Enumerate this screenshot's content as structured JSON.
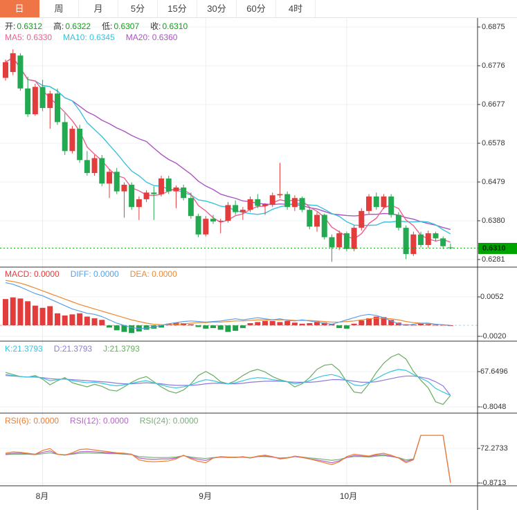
{
  "colors": {
    "accent_tab": "#ef7446",
    "up": "#e23c3c",
    "down": "#23a94f",
    "ohlc_value_green": "#0da314",
    "ma5": "#ee5f8e",
    "ma10": "#36c2dc",
    "ma20": "#ab53c3",
    "macd_bar_pos": "#e23c3c",
    "macd_bar_neg": "#1fa04a",
    "diff": "#58a0e8",
    "dea": "#f0882e",
    "k": "#38c4de",
    "d": "#8f7ad8",
    "j": "#68ac60",
    "rsi6": "#ef7c2e",
    "rsi12": "#b564c9",
    "rsi24": "#78ae78",
    "price_line": "#00a400",
    "grid": "#edf2f6",
    "grid_vertical": "#e7eef4",
    "axis_line": "#333333",
    "separator": "#333333",
    "text": "#333333"
  },
  "tabs": [
    {
      "label": "日",
      "active": true
    },
    {
      "label": "周",
      "active": false
    },
    {
      "label": "月",
      "active": false
    },
    {
      "label": "5分",
      "active": false
    },
    {
      "label": "15分",
      "active": false
    },
    {
      "label": "30分",
      "active": false
    },
    {
      "label": "60分",
      "active": false
    },
    {
      "label": "4时",
      "active": false
    }
  ],
  "main_chart": {
    "legend_ohlc": [
      {
        "label": "开:",
        "value": "0.6312"
      },
      {
        "label": "高:",
        "value": "0.6322"
      },
      {
        "label": "低:",
        "value": "0.6307"
      },
      {
        "label": "收:",
        "value": "0.6310"
      }
    ],
    "legend_ma": [
      {
        "text": "MA5: 0.6330",
        "color_key": "ma5"
      },
      {
        "text": "MA10: 0.6345",
        "color_key": "ma10"
      },
      {
        "text": "MA20: 0.6360",
        "color_key": "ma20"
      }
    ]
  },
  "y_axis": {
    "labels": [
      {
        "text": "0.6875",
        "value": 0.6875
      },
      {
        "text": "0.6776",
        "value": 0.6776
      },
      {
        "text": "0.6677",
        "value": 0.6677
      },
      {
        "text": "0.6578",
        "value": 0.6578
      },
      {
        "text": "0.6479",
        "value": 0.6479
      },
      {
        "text": "0.6380",
        "value": 0.638
      },
      {
        "text": "0.6281",
        "value": 0.6281
      }
    ],
    "current_price": {
      "text": "0.6310",
      "value": 0.631
    }
  },
  "x_axis": {
    "labels": [
      {
        "text": "8月",
        "candle_index": 5
      },
      {
        "text": "9月",
        "candle_index": 27
      },
      {
        "text": "10月",
        "candle_index": 46
      }
    ]
  },
  "panels": {
    "macd": {
      "legend": [
        {
          "text": "MACD: 0.0000",
          "color_key": "macd_bar_pos"
        },
        {
          "text": "DIFF: 0.0000",
          "color_key": "diff"
        },
        {
          "text": "DEA: 0.0000",
          "color_key": "dea"
        }
      ],
      "axis_labels": [
        {
          "text": "0.0052",
          "value": 0.0052
        },
        {
          "text": "-0.0020",
          "value": -0.002
        }
      ]
    },
    "kdj": {
      "legend": [
        {
          "text": "K:21.3793",
          "color_key": "k"
        },
        {
          "text": "D:21.3793",
          "color_key": "d"
        },
        {
          "text": "J:21.3793",
          "color_key": "j"
        }
      ],
      "axis_labels": [
        {
          "text": "67.6496",
          "value": 67.6496
        },
        {
          "text": "-0.8048",
          "value": -0.8048
        }
      ]
    },
    "rsi": {
      "legend": [
        {
          "text": "RSI(6): 0.0000",
          "color_key": "rsi6"
        },
        {
          "text": "RSI(12): 0.0000",
          "color_key": "rsi12"
        },
        {
          "text": "RSI(24): 0.0000",
          "color_key": "rsi24"
        }
      ],
      "axis_labels": [
        {
          "text": "72.2733",
          "value": 72.2733
        },
        {
          "text": "-0.8713",
          "value": -0.8713
        }
      ]
    }
  },
  "chart_data": {
    "type": "candlestick",
    "period": "日",
    "title": "",
    "ylim_main": [
      0.6281,
      0.6875
    ],
    "ylim_macd": [
      -0.002,
      0.0052
    ],
    "ylim_kdj": [
      -0.8048,
      67.6496
    ],
    "ylim_rsi": [
      -0.8713,
      72.2733
    ],
    "ma_periods": [
      5,
      10,
      20
    ],
    "candles": [
      [
        0.6745,
        0.6792,
        0.6738,
        0.6785
      ],
      [
        0.676,
        0.6818,
        0.6752,
        0.6808
      ],
      [
        0.6802,
        0.6808,
        0.6712,
        0.6718
      ],
      [
        0.6718,
        0.6748,
        0.6645,
        0.6652
      ],
      [
        0.6652,
        0.673,
        0.6648,
        0.6722
      ],
      [
        0.6722,
        0.674,
        0.666,
        0.6668
      ],
      [
        0.6668,
        0.6712,
        0.6615,
        0.6705
      ],
      [
        0.6705,
        0.6718,
        0.6625,
        0.6632
      ],
      [
        0.6632,
        0.6655,
        0.6548,
        0.6558
      ],
      [
        0.6558,
        0.6622,
        0.6552,
        0.6615
      ],
      [
        0.6615,
        0.6625,
        0.6528,
        0.6535
      ],
      [
        0.6535,
        0.6558,
        0.6495,
        0.6502
      ],
      [
        0.6502,
        0.6548,
        0.6495,
        0.654
      ],
      [
        0.654,
        0.6548,
        0.6468,
        0.6475
      ],
      [
        0.6475,
        0.6512,
        0.6438,
        0.6505
      ],
      [
        0.6505,
        0.6515,
        0.6448,
        0.6455
      ],
      [
        0.6455,
        0.6478,
        0.6388,
        0.6472
      ],
      [
        0.6472,
        0.6478,
        0.6408,
        0.6415
      ],
      [
        0.6415,
        0.6442,
        0.6382,
        0.6435
      ],
      [
        0.6435,
        0.6458,
        0.6428,
        0.6452
      ],
      [
        0.6452,
        0.6468,
        0.6382,
        0.6448
      ],
      [
        0.6448,
        0.6495,
        0.6442,
        0.6488
      ],
      [
        0.6488,
        0.6495,
        0.6448,
        0.6455
      ],
      [
        0.6455,
        0.647,
        0.6412,
        0.6465
      ],
      [
        0.6465,
        0.6472,
        0.6432,
        0.6438
      ],
      [
        0.6438,
        0.6452,
        0.6385,
        0.6392
      ],
      [
        0.6392,
        0.6398,
        0.6338,
        0.6345
      ],
      [
        0.6345,
        0.6392,
        0.634,
        0.6385
      ],
      [
        0.6385,
        0.6395,
        0.6372,
        0.6378
      ],
      [
        0.6378,
        0.6385,
        0.6348,
        0.638
      ],
      [
        0.638,
        0.6428,
        0.6375,
        0.642
      ],
      [
        0.642,
        0.6432,
        0.6395,
        0.6402
      ],
      [
        0.6402,
        0.6415,
        0.6382,
        0.6408
      ],
      [
        0.6408,
        0.6442,
        0.6402,
        0.6435
      ],
      [
        0.6435,
        0.6448,
        0.6412,
        0.6418
      ],
      [
        0.6418,
        0.6425,
        0.6395,
        0.6422
      ],
      [
        0.6422,
        0.6452,
        0.6415,
        0.6445
      ],
      [
        0.6445,
        0.6528,
        0.6438,
        0.6448
      ],
      [
        0.6448,
        0.6455,
        0.6408,
        0.6415
      ],
      [
        0.6415,
        0.6445,
        0.6405,
        0.6438
      ],
      [
        0.6438,
        0.6442,
        0.6402,
        0.6408
      ],
      [
        0.6408,
        0.6415,
        0.6358,
        0.6365
      ],
      [
        0.6365,
        0.6402,
        0.6352,
        0.6395
      ],
      [
        0.6395,
        0.6398,
        0.6332,
        0.6338
      ],
      [
        0.6338,
        0.6345,
        0.6275,
        0.6312
      ],
      [
        0.6312,
        0.6355,
        0.6305,
        0.6348
      ],
      [
        0.6348,
        0.6352,
        0.6302,
        0.6308
      ],
      [
        0.6308,
        0.6368,
        0.6302,
        0.6362
      ],
      [
        0.6362,
        0.6412,
        0.6355,
        0.6405
      ],
      [
        0.6405,
        0.6448,
        0.6398,
        0.6442
      ],
      [
        0.6442,
        0.6452,
        0.6408,
        0.6415
      ],
      [
        0.6415,
        0.6448,
        0.641,
        0.6442
      ],
      [
        0.6442,
        0.6448,
        0.6388,
        0.6395
      ],
      [
        0.6395,
        0.6402,
        0.6355,
        0.6362
      ],
      [
        0.6362,
        0.6368,
        0.6282,
        0.6295
      ],
      [
        0.6295,
        0.6352,
        0.629,
        0.6345
      ],
      [
        0.6345,
        0.6352,
        0.6312,
        0.6318
      ],
      [
        0.6318,
        0.6355,
        0.631,
        0.6348
      ],
      [
        0.6348,
        0.6352,
        0.6328,
        0.6335
      ],
      [
        0.6335,
        0.634,
        0.6308,
        0.6315
      ],
      [
        0.6312,
        0.6322,
        0.6307,
        0.631
      ]
    ],
    "macd": {
      "hist": [
        0.0048,
        0.0051,
        0.0049,
        0.0044,
        0.0036,
        0.0032,
        0.0035,
        0.0022,
        0.0018,
        0.002,
        0.0022,
        0.0016,
        0.0013,
        0.001,
        -0.0004,
        -0.0009,
        -0.0012,
        -0.0014,
        -0.0011,
        -0.0008,
        -0.0006,
        -0.0004,
        0.0003,
        0.0005,
        0.0004,
        0.0002,
        -0.0003,
        -0.0006,
        -0.0005,
        -0.0008,
        -0.0012,
        -0.001,
        -0.0005,
        0.0004,
        0.0006,
        0.0008,
        0.0008,
        0.0006,
        0.0008,
        0.0005,
        0.0003,
        0.0004,
        0.0007,
        0.0005,
        0.0003,
        -0.0005,
        -0.0006,
        0.0003,
        0.0009,
        0.0013,
        0.0016,
        0.0015,
        0.001,
        0.0005,
        0.0002,
        0.0001,
        0.0003,
        0.0002,
        0.0001,
        0.0001,
        0.0
      ],
      "diff": [
        0.0078,
        0.0075,
        0.007,
        0.0064,
        0.0058,
        0.0054,
        0.0048,
        0.0042,
        0.0036,
        0.003,
        0.0026,
        0.0022,
        0.002,
        0.0016,
        0.001,
        0.0004,
        0.0,
        -0.0004,
        -0.0006,
        -0.0005,
        -0.0003,
        0.0,
        0.0003,
        0.0005,
        0.0007,
        0.0008,
        0.0007,
        0.0006,
        0.0007,
        0.0008,
        0.001,
        0.0012,
        0.001,
        0.0012,
        0.0014,
        0.0012,
        0.001,
        0.0012,
        0.0009,
        0.0008,
        0.001,
        0.0008,
        0.0006,
        0.0004,
        0.0002,
        0.0006,
        0.001,
        0.0014,
        0.0018,
        0.002,
        0.0018,
        0.0014,
        0.0008,
        0.0003,
        0.0,
        0.0002,
        0.0004,
        0.0004,
        0.0002,
        0.0001,
        0.0
      ],
      "dea": [
        0.0082,
        0.008,
        0.0077,
        0.0073,
        0.0068,
        0.0063,
        0.0058,
        0.0053,
        0.0048,
        0.0043,
        0.0038,
        0.0034,
        0.003,
        0.0026,
        0.0022,
        0.0018,
        0.0014,
        0.001,
        0.0007,
        0.0004,
        0.0002,
        0.0001,
        0.0001,
        0.0002,
        0.0003,
        0.0004,
        0.0005,
        0.0005,
        0.0006,
        0.0006,
        0.0007,
        0.0008,
        0.0008,
        0.0009,
        0.001,
        0.001,
        0.001,
        0.001,
        0.001,
        0.0009,
        0.0009,
        0.0009,
        0.0008,
        0.0007,
        0.0006,
        0.0006,
        0.0007,
        0.0008,
        0.001,
        0.0012,
        0.0013,
        0.0013,
        0.0012,
        0.001,
        0.0007,
        0.0005,
        0.0004,
        0.0003,
        0.0002,
        0.0001,
        0.0
      ]
    },
    "kdj": {
      "k": [
        62,
        60,
        58,
        57,
        58,
        55,
        50,
        52,
        54,
        50,
        48,
        46,
        47,
        45,
        42,
        40,
        42,
        45,
        48,
        50,
        46,
        42,
        38,
        36,
        38,
        42,
        48,
        52,
        50,
        46,
        44,
        46,
        50,
        54,
        56,
        55,
        52,
        50,
        48,
        44,
        46,
        50,
        56,
        60,
        62,
        58,
        50,
        42,
        40,
        46,
        54,
        62,
        68,
        72,
        70,
        62,
        55,
        48,
        35,
        28,
        21.4
      ],
      "d": [
        60,
        59,
        58,
        57,
        57,
        56,
        54,
        53,
        53,
        52,
        51,
        50,
        49,
        48,
        47,
        45,
        44,
        44,
        45,
        46,
        45,
        44,
        42,
        41,
        41,
        41,
        42,
        44,
        45,
        45,
        44,
        44,
        45,
        47,
        48,
        49,
        49,
        49,
        48,
        47,
        47,
        47,
        48,
        50,
        52,
        52,
        51,
        49,
        47,
        47,
        48,
        51,
        54,
        57,
        59,
        59,
        57,
        54,
        48,
        40,
        21.4
      ]
    },
    "rsi": {
      "rsi6": [
        62,
        65,
        64,
        62,
        60,
        68,
        72,
        60,
        58,
        63,
        70,
        71,
        69,
        67,
        65,
        63,
        62,
        60,
        48,
        45,
        44,
        45,
        46,
        50,
        58,
        50,
        45,
        42,
        52,
        55,
        54,
        53,
        55,
        52,
        56,
        58,
        55,
        50,
        52,
        56,
        54,
        50,
        46,
        42,
        38,
        44,
        55,
        60,
        58,
        56,
        60,
        62,
        58,
        52,
        42,
        48,
        100,
        100,
        100,
        100,
        0
      ],
      "rsi12": [
        60,
        62,
        62,
        61,
        60,
        64,
        67,
        60,
        58,
        61,
        65,
        66,
        65,
        64,
        63,
        62,
        61,
        60,
        52,
        50,
        49,
        50,
        50,
        52,
        57,
        52,
        49,
        47,
        52,
        54,
        53,
        53,
        54,
        52,
        55,
        56,
        54,
        51,
        52,
        55,
        53,
        50,
        48,
        45,
        42,
        46,
        53,
        57,
        56,
        55,
        58,
        59,
        56,
        52,
        45,
        49,
        100,
        100,
        100,
        100,
        0
      ],
      "rsi24": [
        59,
        60,
        60,
        60,
        59,
        61,
        63,
        60,
        59,
        60,
        62,
        63,
        62,
        62,
        61,
        61,
        60,
        59,
        55,
        54,
        53,
        53,
        53,
        54,
        57,
        54,
        52,
        51,
        53,
        54,
        54,
        54,
        54,
        53,
        55,
        55,
        54,
        52,
        53,
        55,
        54,
        52,
        51,
        49,
        47,
        49,
        53,
        55,
        55,
        54,
        56,
        57,
        55,
        53,
        48,
        50,
        100,
        100,
        100,
        100,
        0
      ]
    }
  }
}
